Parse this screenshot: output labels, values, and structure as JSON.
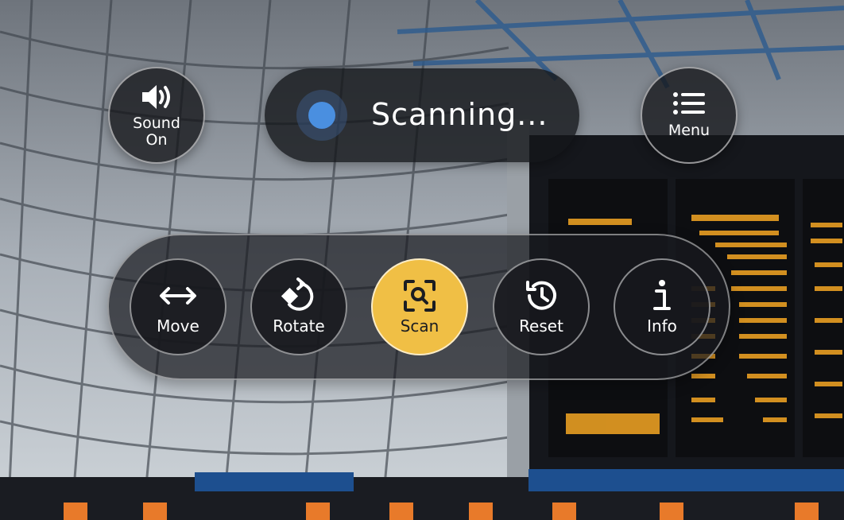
{
  "top_bar": {
    "sound": {
      "label_line1": "Sound",
      "label_line2": "On",
      "icon": "speaker-icon"
    },
    "status": {
      "text": "Scanning...",
      "indicator_color": "#4a8fe0"
    },
    "menu": {
      "label": "Menu",
      "icon": "list-icon"
    }
  },
  "tools": {
    "move": {
      "label": "Move",
      "icon": "move-arrows-icon"
    },
    "rotate": {
      "label": "Rotate",
      "icon": "rotate-icon"
    },
    "scan": {
      "label": "Scan",
      "icon": "scan-icon",
      "active": true
    },
    "reset": {
      "label": "Reset",
      "icon": "history-icon"
    },
    "info": {
      "label": "Info",
      "icon": "info-icon"
    }
  },
  "colors": {
    "accent": "#f0bf45",
    "panel": "#16181c",
    "status_dot": "#4a8fe0",
    "departure_board_text": "#f5a623"
  }
}
